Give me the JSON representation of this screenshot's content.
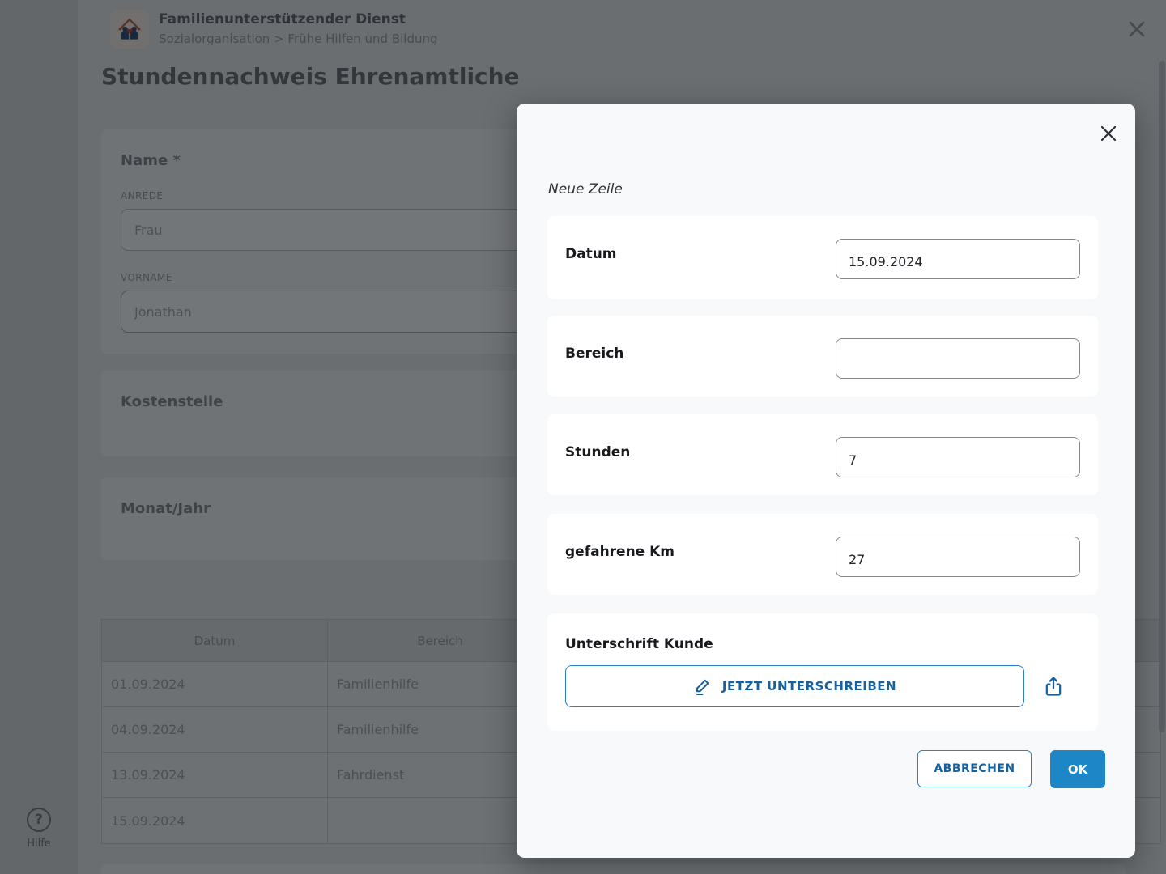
{
  "header": {
    "app_title": "Familienunterstützender Dienst",
    "breadcrumb": "Sozialorganisation > Frühe Hilfen und Bildung"
  },
  "page": {
    "title": "Stundennachweis Ehrenamtliche",
    "help_label": "Hilfe",
    "help_glyph": "?"
  },
  "form": {
    "name_section_title": "Name *",
    "anrede_label": "ANREDE",
    "anrede_value": "Frau",
    "vorname_label": "VORNAME",
    "vorname_value": "Jonathan",
    "kostenstelle_title": "Kostenstelle",
    "monat_jahr_title": "Monat/Jahr"
  },
  "table": {
    "columns": [
      "Datum",
      "Bereich"
    ],
    "rows": [
      {
        "datum": "01.09.2024",
        "bereich": "Familienhilfe"
      },
      {
        "datum": "04.09.2024",
        "bereich": "Familienhilfe"
      },
      {
        "datum": "13.09.2024",
        "bereich": "Fahrdienst"
      },
      {
        "datum": "15.09.2024",
        "bereich": ""
      }
    ]
  },
  "modal": {
    "title": "Neue Zeile",
    "fields": [
      {
        "label": "Datum",
        "value": "15.09.2024"
      },
      {
        "label": "Bereich",
        "value": ""
      },
      {
        "label": "Stunden",
        "value": "7"
      },
      {
        "label": "gefahrene Km",
        "value": "27"
      }
    ],
    "signature_label": "Unterschrift Kunde",
    "sign_button_label": "JETZT UNTERSCHREIBEN",
    "cancel_label": "ABBRECHEN",
    "ok_label": "OK"
  },
  "icons": {
    "logo": "family-house-logo",
    "close": "close-icon",
    "help": "question-mark-icon",
    "pencil": "pencil-icon",
    "upload": "upload-icon"
  },
  "colors": {
    "accent_blue": "#1d86c6",
    "deep_blue": "#15609f",
    "modal_bg": "#f8f9fa"
  }
}
